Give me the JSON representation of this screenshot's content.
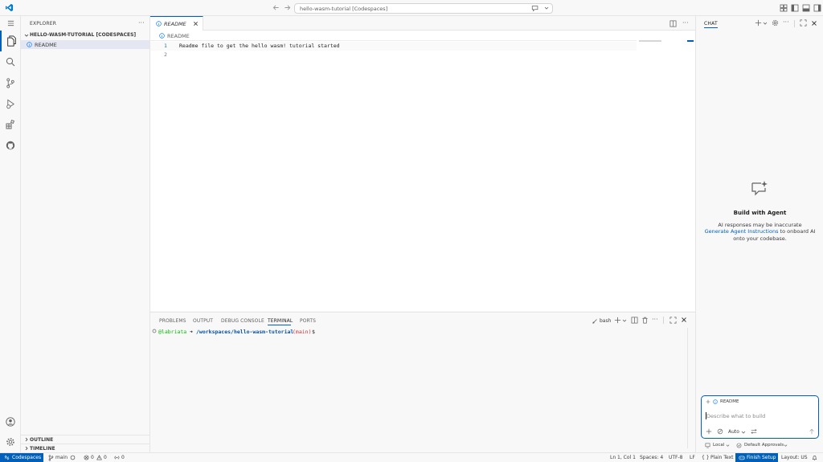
{
  "titlebar": {
    "search_text": "hello-wasm-tutorial [Codespaces]"
  },
  "sidebar": {
    "title": "EXPLORER",
    "folder": "HELLO-WASM-TUTORIAL [CODESPACES]",
    "files": [
      {
        "name": "README"
      }
    ],
    "outline_label": "OUTLINE",
    "timeline_label": "TIMELINE"
  },
  "editor": {
    "tab_label": "README",
    "breadcrumb": "README",
    "lines": [
      {
        "num": "1",
        "text": "Readme file to get the hello wasm! tutorial started"
      },
      {
        "num": "2",
        "text": ""
      }
    ]
  },
  "panel": {
    "tabs": [
      "PROBLEMS",
      "OUTPUT",
      "DEBUG CONSOLE",
      "TERMINAL",
      "PORTS"
    ],
    "active_tab": "TERMINAL",
    "shell_label": "bash",
    "terminal": {
      "user": "@labriata",
      "arrow": "➜",
      "path": "/workspaces/hello-wasm-tutorial",
      "branch": "(main)",
      "prompt": "$"
    }
  },
  "chat": {
    "title": "CHAT",
    "heading": "Build with Agent",
    "note": "AI responses may be inaccurate",
    "link_text": "Generate Agent Instructions",
    "tail_text_1": "to onboard AI",
    "tail_text_2": "onto your codebase.",
    "context_file": "README",
    "input_placeholder": "Describe what to build",
    "mode_label": "Auto",
    "location_label": "Local",
    "approvals_label": "Default Approvals"
  },
  "statusbar": {
    "remote_label": "Codespaces",
    "branch": "main",
    "errors": "0",
    "warnings": "0",
    "ports": "0",
    "position": "Ln 1, Col 1",
    "spaces": "Spaces: 4",
    "encoding": "UTF-8",
    "eol": "LF",
    "language": "Plain Text",
    "finish_setup": "Finish Setup",
    "layout": "Layout: US"
  },
  "colors": {
    "accent": "#005fb8",
    "terminal_user": "#00bc00",
    "terminal_path": "#0451a5",
    "terminal_branch": "#cd3131"
  }
}
